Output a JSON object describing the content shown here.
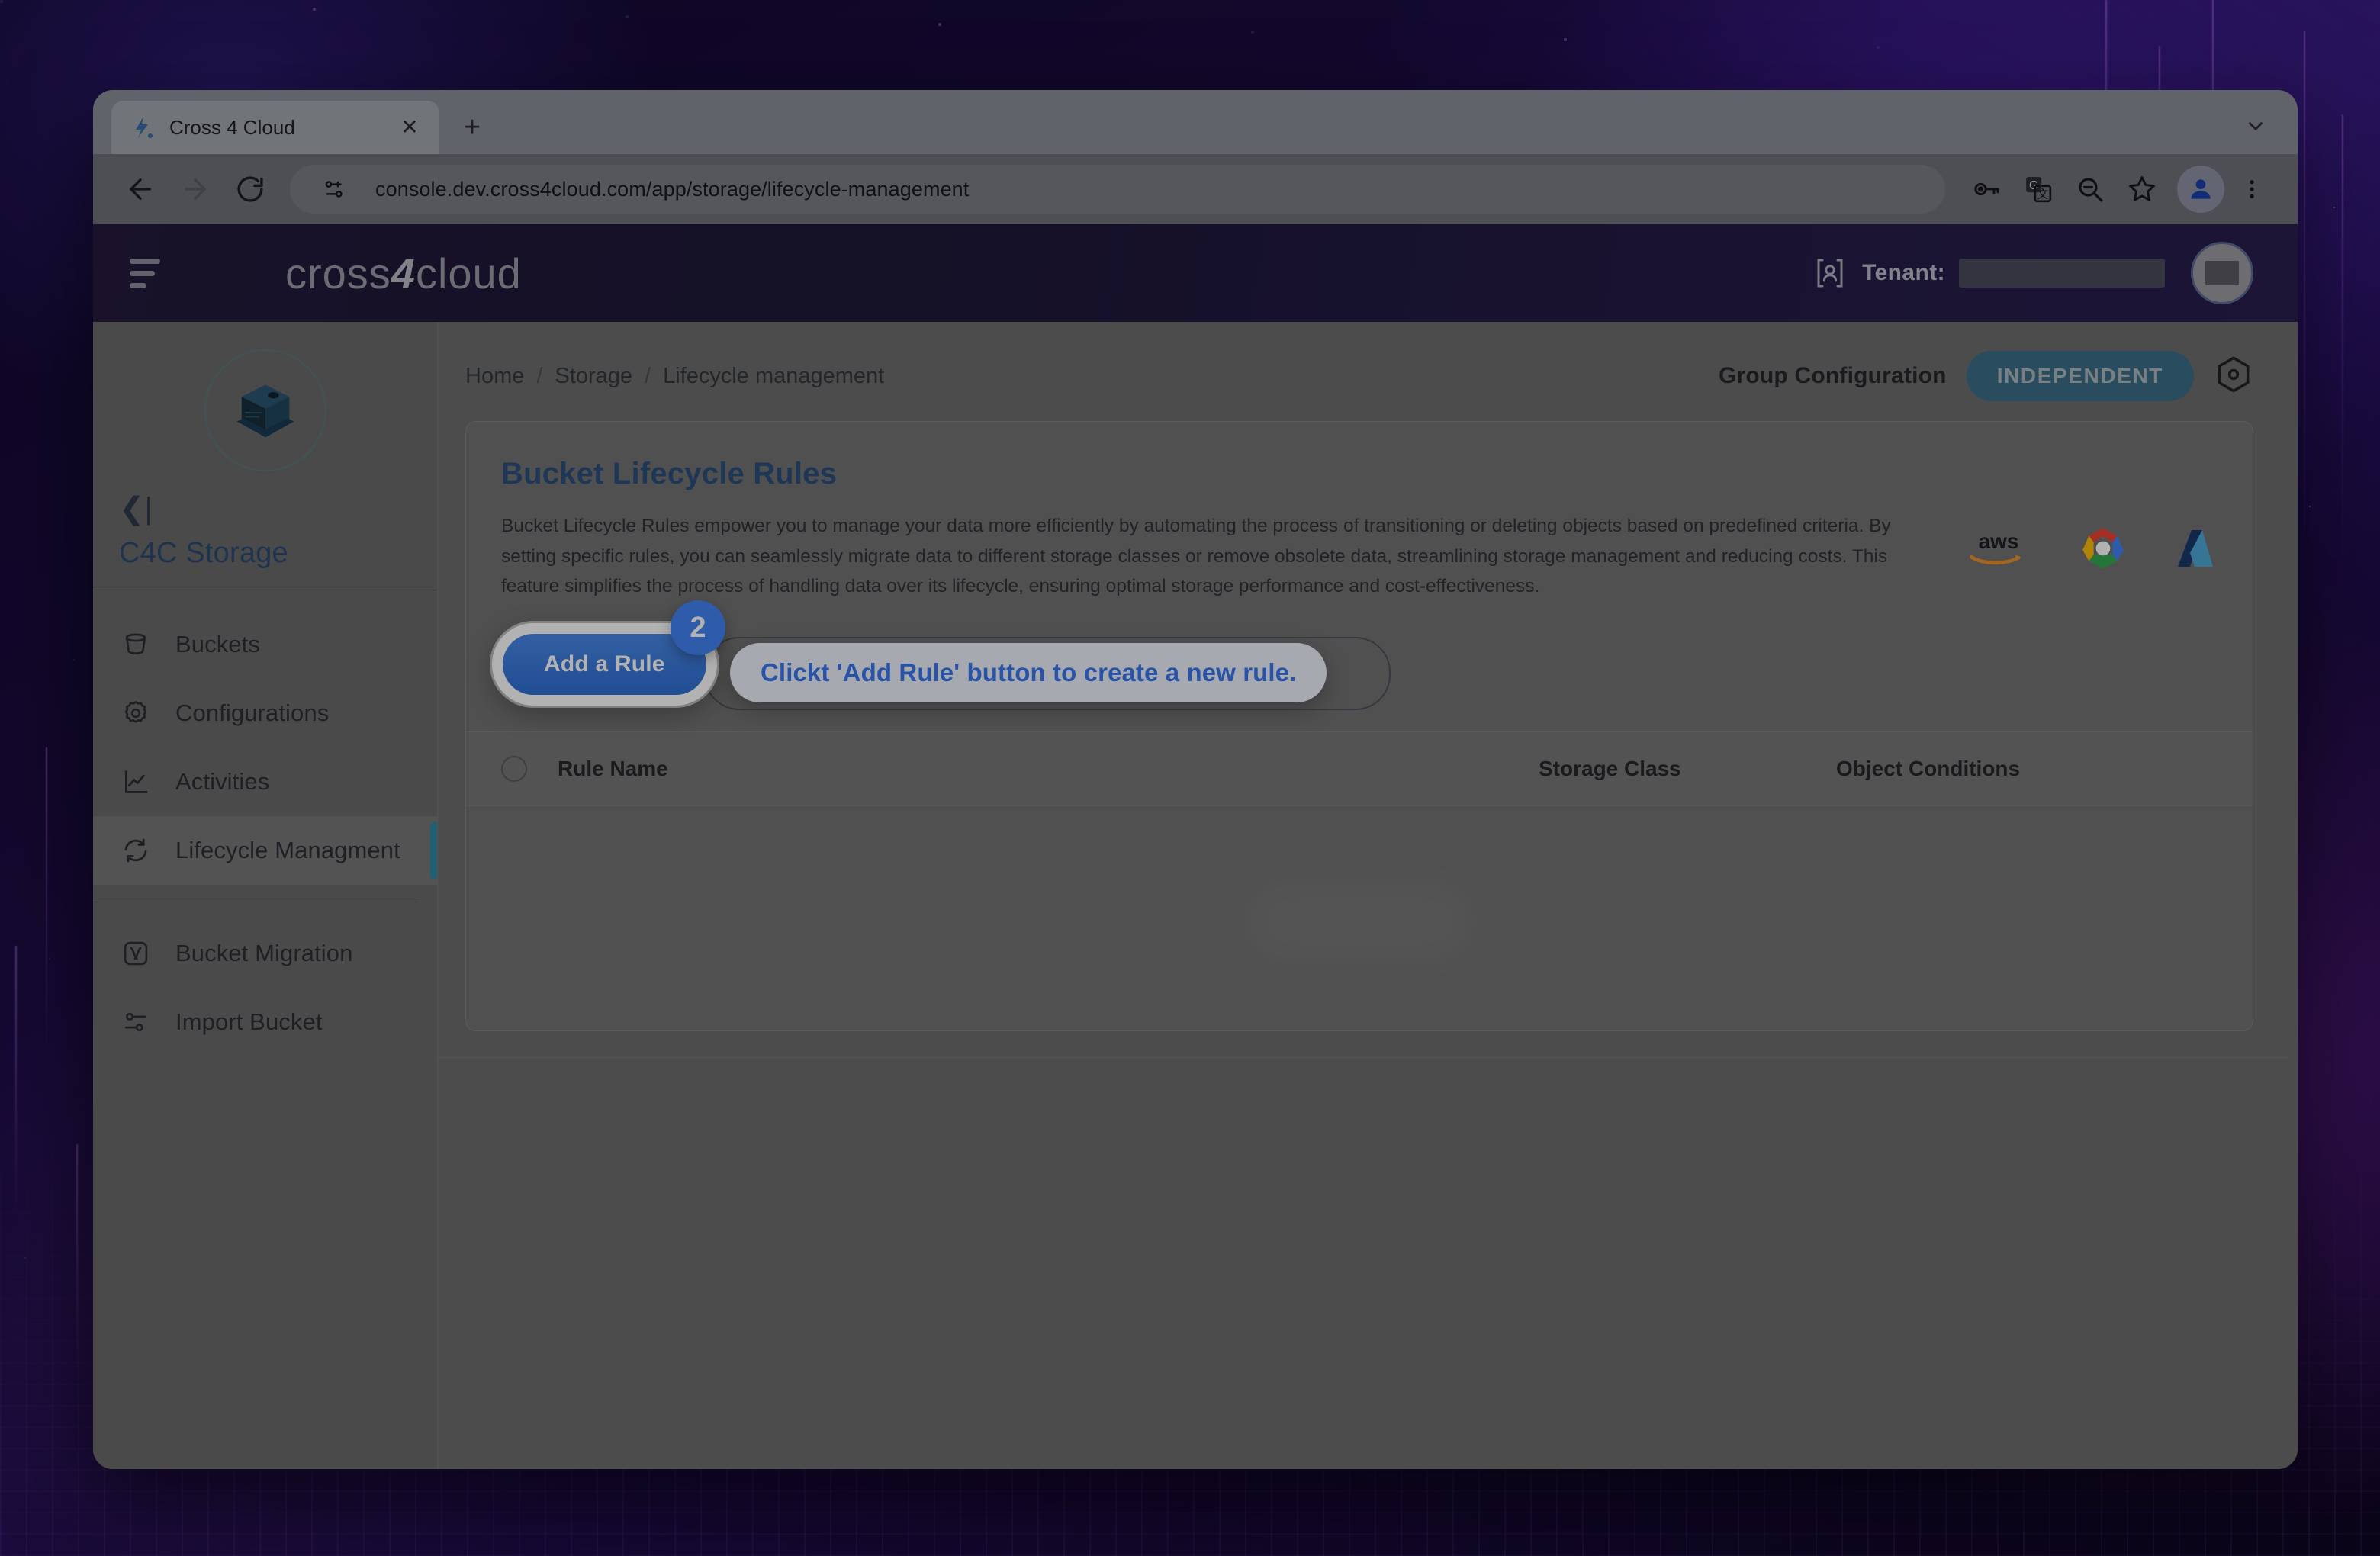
{
  "browser": {
    "tab": {
      "title": "Cross 4 Cloud",
      "favicon_icon": "cross4cloud-favicon",
      "close_icon": "close-icon"
    },
    "new_tab_icon": "plus-icon",
    "tabstrip_menu_icon": "chevron-down-icon",
    "nav": {
      "back_icon": "back-arrow-icon",
      "forward_icon": "forward-arrow-icon",
      "reload_icon": "reload-icon"
    },
    "url": "console.dev.cross4cloud.com/app/storage/lifecycle-management",
    "site_info_icon": "site-settings-icon",
    "toolbar_icons": [
      "password-key-icon",
      "translate-icon",
      "zoom-out-icon",
      "bookmark-star-icon",
      "profile-avatar-icon",
      "three-dot-menu-icon"
    ]
  },
  "appbar": {
    "menu_icon": "hamburger-menu-icon",
    "brand_part1": "cross",
    "brand_part2": "4",
    "brand_part3": "cloud",
    "tenant_icon": "tenant-user-icon",
    "tenant_label": "Tenant:",
    "tenant_value": "",
    "avatar_icon": "user-avatar"
  },
  "sidebar": {
    "app_icon": "storage-cube-icon",
    "collapse_icon": "collapse-left-icon",
    "title": "C4C Storage",
    "items": [
      {
        "label": "Buckets",
        "icon": "bucket-icon",
        "active": false
      },
      {
        "label": "Configurations",
        "icon": "gear-icon",
        "active": false
      },
      {
        "label": "Activities",
        "icon": "activity-chart-icon",
        "active": false
      },
      {
        "label": "Lifecycle Managment",
        "icon": "refresh-cycle-icon",
        "active": true
      },
      {
        "label": "Bucket Migration",
        "icon": "migration-icon",
        "active": false
      },
      {
        "label": "Import Bucket",
        "icon": "import-sliders-icon",
        "active": false
      }
    ]
  },
  "breadcrumb": {
    "items": [
      "Home",
      "Storage",
      "Lifecycle management"
    ],
    "separator": "/"
  },
  "group_configuration": {
    "label": "Group Configuration",
    "badge": "INDEPENDENT",
    "settings_icon": "hexagon-settings-icon"
  },
  "card": {
    "title": "Bucket Lifecycle Rules",
    "description": "Bucket Lifecycle Rules empower you to manage your data more efficiently by automating the process of transitioning or deleting objects based on predefined criteria. By setting specific rules, you can seamlessly migrate data to different storage classes or remove obsolete data, streamlining storage management and reducing costs. This feature simplifies the process of handling data over its lifecycle, ensuring optimal storage performance and cost-effectiveness.",
    "providers": [
      {
        "name": "aws",
        "icon": "aws-logo"
      },
      {
        "name": "Google Cloud",
        "icon": "google-cloud-logo"
      },
      {
        "name": "Azure",
        "icon": "azure-logo"
      }
    ],
    "add_rule_button": "Add a Rule"
  },
  "coachmark": {
    "step_number": "2",
    "text": "Clickt 'Add Rule' button to create a new rule."
  },
  "table": {
    "select_all_icon": "checkbox-circle-icon",
    "columns": [
      "Rule Name",
      "Storage Class",
      "Object Conditions"
    ],
    "rows": []
  },
  "colors": {
    "accent_blue": "#3c78ef",
    "button_blue": "#2f6fd4",
    "badge_teal": "#3b6f88",
    "title_blue": "#2d4f7c",
    "sidebar_active_indicator": "#2f8aa8"
  }
}
